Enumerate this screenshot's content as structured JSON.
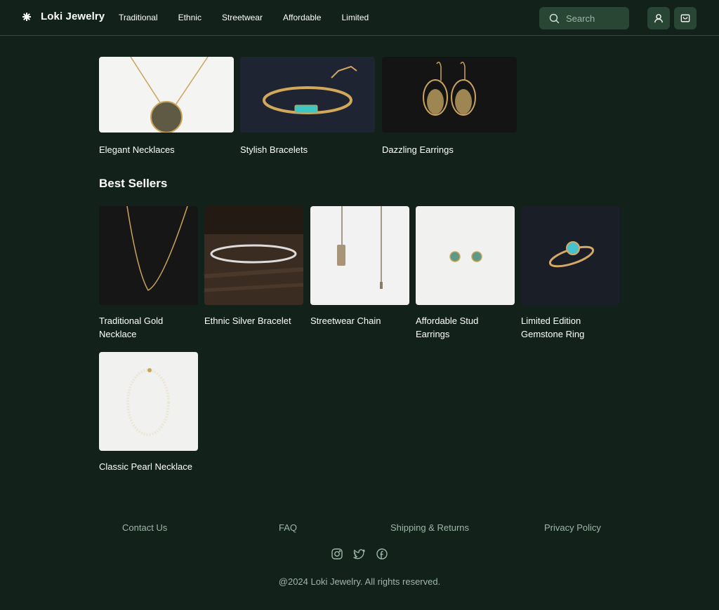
{
  "brand": {
    "name": "Loki Jewelry"
  },
  "nav": [
    "Traditional",
    "Ethnic",
    "Streetwear",
    "Affordable",
    "Limited"
  ],
  "search": {
    "placeholder": "Search"
  },
  "header_icons": [
    "user-icon",
    "cart-icon"
  ],
  "categories": [
    {
      "label": "Elegant Necklaces"
    },
    {
      "label": "Stylish Bracelets"
    },
    {
      "label": "Dazzling Earrings"
    }
  ],
  "best_sellers": {
    "title": "Best Sellers",
    "items": [
      {
        "label": "Traditional Gold Necklace"
      },
      {
        "label": "Ethnic Silver Bracelet"
      },
      {
        "label": "Streetwear Chain"
      },
      {
        "label": "Affordable Stud Earrings"
      },
      {
        "label": "Limited Edition Gemstone Ring"
      },
      {
        "label": "Classic Pearl Necklace"
      }
    ]
  },
  "footer": {
    "links": [
      "Contact Us",
      "FAQ",
      "Shipping & Returns",
      "Privacy Policy"
    ],
    "socials": [
      "instagram-icon",
      "twitter-icon",
      "facebook-icon"
    ],
    "copyright": "@2024 Loki Jewelry. All rights reserved."
  },
  "colors": {
    "background": "#12211a",
    "accent_button": "#294534",
    "muted_text": "#9fb7a8"
  }
}
